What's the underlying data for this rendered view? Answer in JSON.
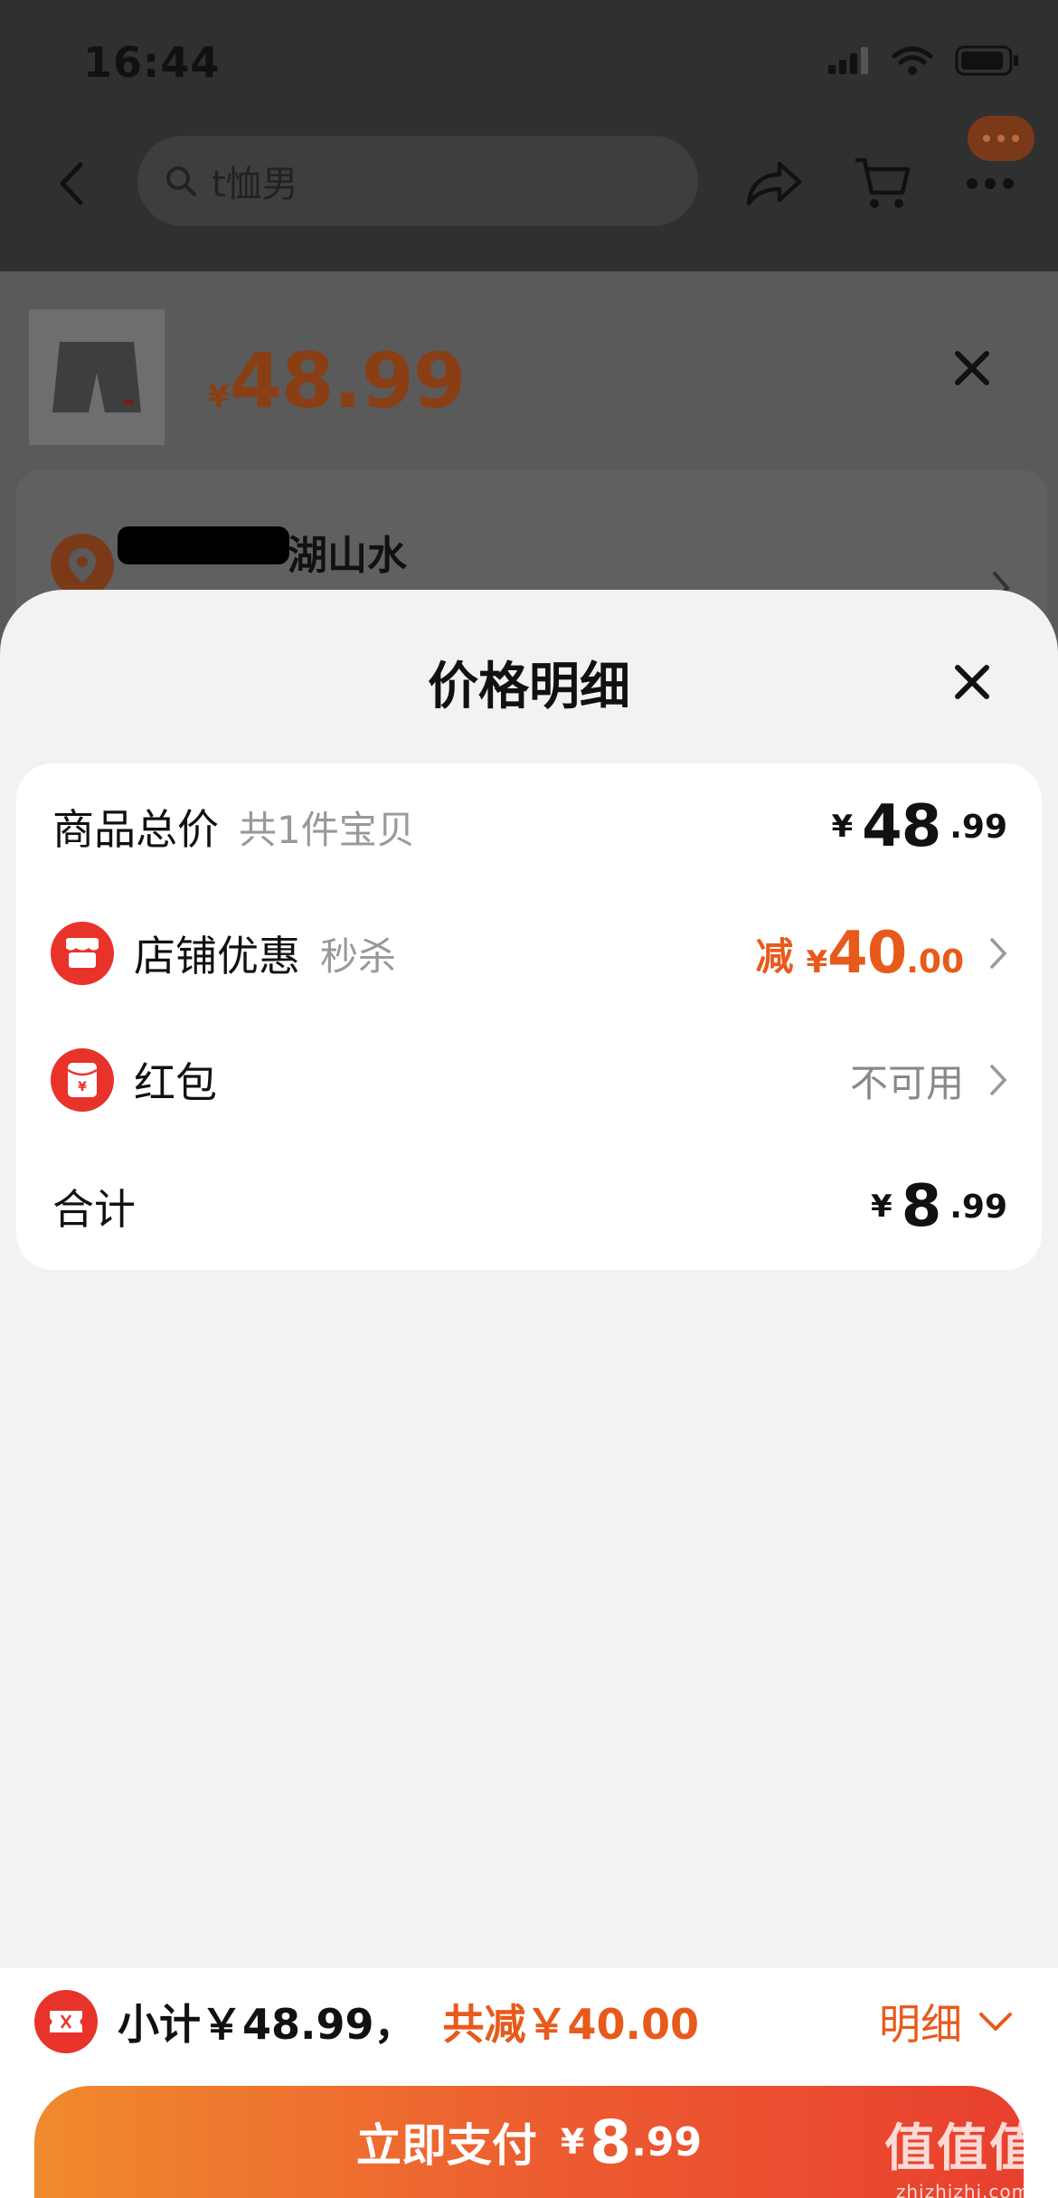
{
  "status_bar": {
    "time": "16:44"
  },
  "nav": {
    "search_text": "t恤男"
  },
  "sku": {
    "currency": "¥",
    "price": "48.99"
  },
  "address": {
    "line1_visible": "湖山水"
  },
  "sheet": {
    "title": "价格明细"
  },
  "rows": {
    "total": {
      "label": "商品总价",
      "sub": "共1件宝贝",
      "cur": "¥",
      "int": "48",
      "dec": ".99"
    },
    "shop_discount": {
      "label": "店铺优惠",
      "sub": "秒杀",
      "prefix": "减",
      "cur": "¥",
      "int": "40",
      "dec": ".00"
    },
    "red_packet": {
      "label": "红包",
      "value": "不可用"
    },
    "sum": {
      "label": "合计",
      "cur": "¥",
      "int": "8",
      "dec": ".99"
    }
  },
  "footer": {
    "subtotal_text": "小计￥48.99，",
    "saved_text": "共减￥40.00",
    "detail_label": "明细",
    "pay_label": "立即支付",
    "pay_cur": "¥",
    "pay_int": "8",
    "pay_dec": ".99"
  },
  "watermark": {
    "main": "值值值",
    "sub": "zhizhizhi.com"
  },
  "colors": {
    "accent": "#e85a1c",
    "red": "#e8332b",
    "sheet_bg": "#f2f2f2"
  }
}
